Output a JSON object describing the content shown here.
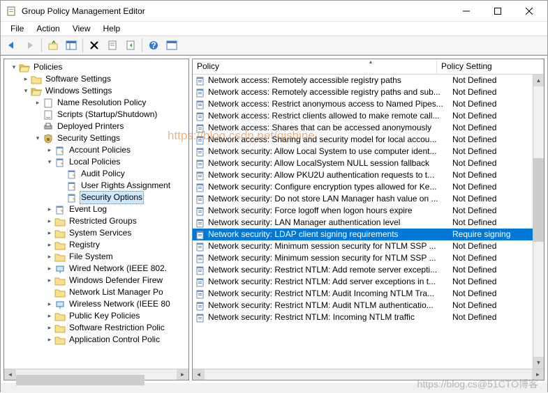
{
  "window": {
    "title": "Group Policy Management Editor"
  },
  "menu": {
    "items": [
      "File",
      "Action",
      "View",
      "Help"
    ]
  },
  "tree": [
    {
      "d": 0,
      "exp": "open",
      "icon": "folder-open",
      "label": "Policies"
    },
    {
      "d": 1,
      "exp": "closed",
      "icon": "folder",
      "label": "Software Settings"
    },
    {
      "d": 1,
      "exp": "open",
      "icon": "folder-open",
      "label": "Windows Settings"
    },
    {
      "d": 2,
      "exp": "closed",
      "icon": "doc",
      "label": "Name Resolution Policy"
    },
    {
      "d": 2,
      "exp": "none",
      "icon": "script",
      "label": "Scripts (Startup/Shutdown)"
    },
    {
      "d": 2,
      "exp": "none",
      "icon": "printer",
      "label": "Deployed Printers"
    },
    {
      "d": 2,
      "exp": "open",
      "icon": "security",
      "label": "Security Settings"
    },
    {
      "d": 3,
      "exp": "closed",
      "icon": "policy",
      "label": "Account Policies"
    },
    {
      "d": 3,
      "exp": "open",
      "icon": "policy",
      "label": "Local Policies"
    },
    {
      "d": 4,
      "exp": "none",
      "icon": "policy",
      "label": "Audit Policy"
    },
    {
      "d": 4,
      "exp": "none",
      "icon": "policy",
      "label": "User Rights Assignment"
    },
    {
      "d": 4,
      "exp": "none",
      "icon": "policy",
      "label": "Security Options",
      "sel": true
    },
    {
      "d": 3,
      "exp": "closed",
      "icon": "policy",
      "label": "Event Log"
    },
    {
      "d": 3,
      "exp": "closed",
      "icon": "folder",
      "label": "Restricted Groups"
    },
    {
      "d": 3,
      "exp": "closed",
      "icon": "folder",
      "label": "System Services"
    },
    {
      "d": 3,
      "exp": "closed",
      "icon": "folder",
      "label": "Registry"
    },
    {
      "d": 3,
      "exp": "closed",
      "icon": "folder",
      "label": "File System"
    },
    {
      "d": 3,
      "exp": "closed",
      "icon": "net",
      "label": "Wired Network (IEEE 802."
    },
    {
      "d": 3,
      "exp": "closed",
      "icon": "folder",
      "label": "Windows Defender Firew"
    },
    {
      "d": 3,
      "exp": "none",
      "icon": "folder",
      "label": "Network List Manager Po"
    },
    {
      "d": 3,
      "exp": "closed",
      "icon": "net",
      "label": "Wireless Network (IEEE 80"
    },
    {
      "d": 3,
      "exp": "closed",
      "icon": "folder",
      "label": "Public Key Policies"
    },
    {
      "d": 3,
      "exp": "closed",
      "icon": "folder",
      "label": "Software Restriction Polic"
    },
    {
      "d": 3,
      "exp": "closed",
      "icon": "folder",
      "label": "Application Control Polic"
    }
  ],
  "columns": {
    "c1": "Policy",
    "c2": "Policy Setting"
  },
  "policies": [
    {
      "n": "Network access: Remotely accessible registry paths",
      "s": "Not Defined"
    },
    {
      "n": "Network access: Remotely accessible registry paths and sub...",
      "s": "Not Defined"
    },
    {
      "n": "Network access: Restrict anonymous access to Named Pipes...",
      "s": "Not Defined"
    },
    {
      "n": "Network access: Restrict clients allowed to make remote call...",
      "s": "Not Defined"
    },
    {
      "n": "Network access: Shares that can be accessed anonymously",
      "s": "Not Defined"
    },
    {
      "n": "Network access: Sharing and security model for local accou...",
      "s": "Not Defined"
    },
    {
      "n": "Network security: Allow Local System to use computer ident...",
      "s": "Not Defined"
    },
    {
      "n": "Network security: Allow LocalSystem NULL session fallback",
      "s": "Not Defined"
    },
    {
      "n": "Network security: Allow PKU2U authentication requests to t...",
      "s": "Not Defined"
    },
    {
      "n": "Network security: Configure encryption types allowed for Ke...",
      "s": "Not Defined"
    },
    {
      "n": "Network security: Do not store LAN Manager hash value on ...",
      "s": "Not Defined"
    },
    {
      "n": "Network security: Force logoff when logon hours expire",
      "s": "Not Defined"
    },
    {
      "n": "Network security: LAN Manager authentication level",
      "s": "Not Defined"
    },
    {
      "n": "Network security: LDAP client signing requirements",
      "s": "Require signing",
      "sel": true
    },
    {
      "n": "Network security: Minimum session security for NTLM SSP ...",
      "s": "Not Defined"
    },
    {
      "n": "Network security: Minimum session security for NTLM SSP ...",
      "s": "Not Defined"
    },
    {
      "n": "Network security: Restrict NTLM: Add remote server excepti...",
      "s": "Not Defined"
    },
    {
      "n": "Network security: Restrict NTLM: Add server exceptions in t...",
      "s": "Not Defined"
    },
    {
      "n": "Network security: Restrict NTLM: Audit Incoming NTLM Tra...",
      "s": "Not Defined"
    },
    {
      "n": "Network security: Restrict NTLM: Audit NTLM authenticatio...",
      "s": "Not Defined"
    },
    {
      "n": "Network security: Restrict NTLM: Incoming NTLM traffic",
      "s": "Not Defined"
    }
  ],
  "wm1": "https://blog.csdn.net/qishine",
  "wm2": "https://blog.cs@51CTO博客"
}
